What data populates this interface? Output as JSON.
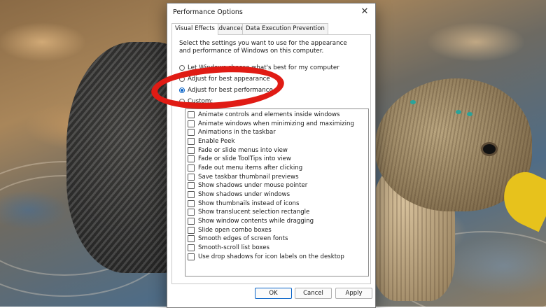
{
  "dialog": {
    "title": "Performance Options",
    "close_glyph": "✕",
    "tabs": [
      {
        "label": "Visual Effects"
      },
      {
        "label": "Advanced"
      },
      {
        "label": "Data Execution Prevention"
      }
    ],
    "description": "Select the settings you want to use for the appearance and performance of Windows on this computer.",
    "radios": [
      {
        "label": "Let Windows choose what's best for my computer",
        "checked": false
      },
      {
        "label": "Adjust for best appearance",
        "checked": false
      },
      {
        "label": "Adjust for best performance",
        "checked": true
      },
      {
        "label": "Custom:",
        "checked": false
      }
    ],
    "options": [
      {
        "label": "Animate controls and elements inside windows",
        "checked": false
      },
      {
        "label": "Animate windows when minimizing and maximizing",
        "checked": false
      },
      {
        "label": "Animations in the taskbar",
        "checked": false
      },
      {
        "label": "Enable Peek",
        "checked": false
      },
      {
        "label": "Fade or slide menus into view",
        "checked": false
      },
      {
        "label": "Fade or slide ToolTips into view",
        "checked": false
      },
      {
        "label": "Fade out menu items after clicking",
        "checked": false
      },
      {
        "label": "Save taskbar thumbnail previews",
        "checked": false
      },
      {
        "label": "Show shadows under mouse pointer",
        "checked": false
      },
      {
        "label": "Show shadows under windows",
        "checked": false
      },
      {
        "label": "Show thumbnails instead of icons",
        "checked": false
      },
      {
        "label": "Show translucent selection rectangle",
        "checked": false
      },
      {
        "label": "Show window contents while dragging",
        "checked": false
      },
      {
        "label": "Slide open combo boxes",
        "checked": false
      },
      {
        "label": "Smooth edges of screen fonts",
        "checked": false
      },
      {
        "label": "Smooth-scroll list boxes",
        "checked": false
      },
      {
        "label": "Use drop shadows for icon labels on the desktop",
        "checked": false
      }
    ],
    "buttons": {
      "ok": "OK",
      "cancel": "Cancel",
      "apply": "Apply"
    }
  },
  "annotation": {
    "color": "#e01b14",
    "shape": "ellipse"
  },
  "colors": {
    "accent": "#0a64c8",
    "bill": "#e7c21c"
  }
}
